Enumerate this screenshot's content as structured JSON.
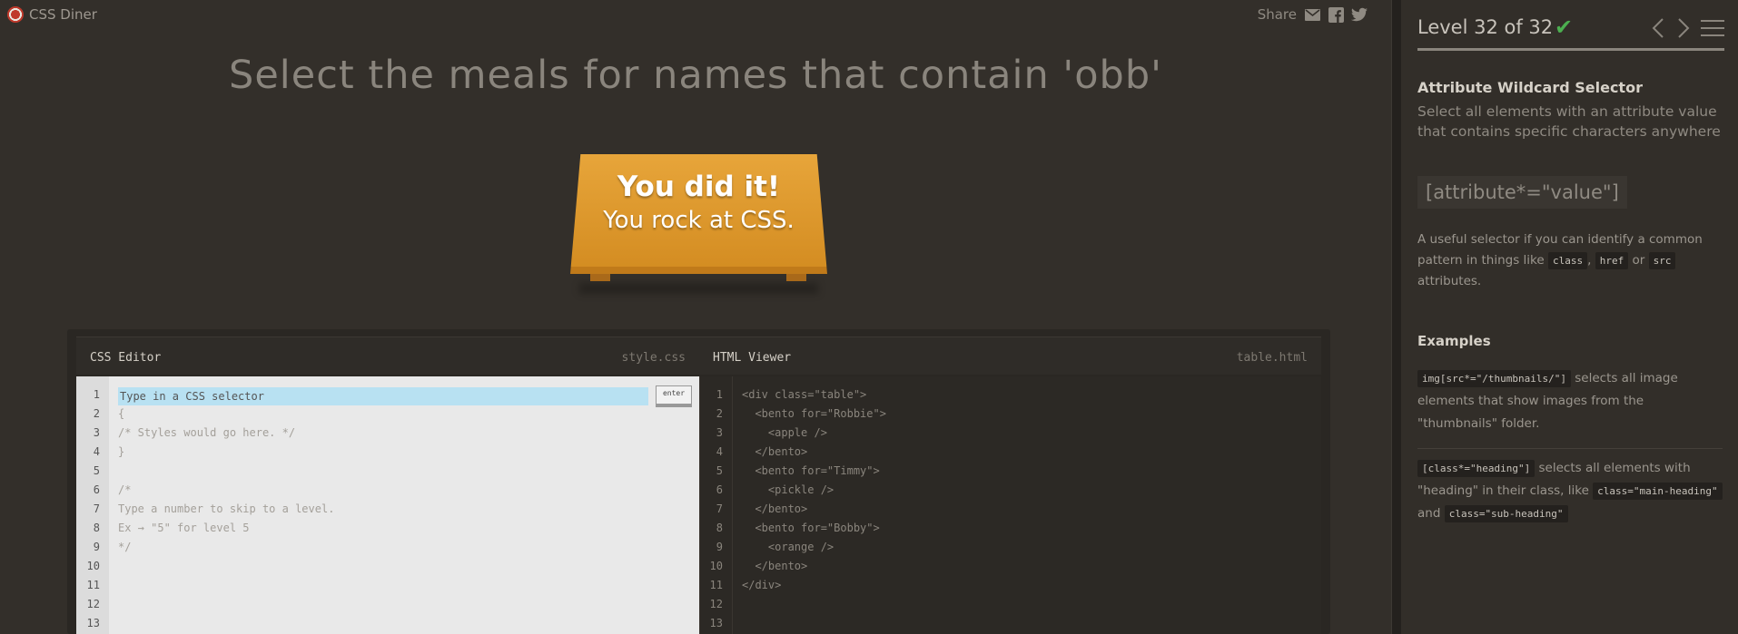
{
  "app": {
    "name": "CSS Diner"
  },
  "share": {
    "label": "Share"
  },
  "instruction": "Select the meals for names that contain 'obb'",
  "table": {
    "line1": "You did it!",
    "line2": "You rock at CSS."
  },
  "css_editor": {
    "title": "CSS Editor",
    "file": "style.css",
    "placeholder": "Type in a CSS selector",
    "enter_label": "enter",
    "line_numbers": [
      "1",
      "2",
      "3",
      "4",
      "5",
      "6",
      "7",
      "8",
      "9",
      "10",
      "11",
      "12",
      "13"
    ],
    "lines": [
      "",
      "{",
      "/* Styles would go here. */",
      "}",
      "",
      "/*",
      "Type a number to skip to a level.",
      "Ex → \"5\" for level 5",
      "*/",
      "",
      "",
      "",
      ""
    ]
  },
  "html_viewer": {
    "title": "HTML Viewer",
    "file": "table.html",
    "line_numbers": [
      "1",
      "2",
      "3",
      "4",
      "5",
      "6",
      "7",
      "8",
      "9",
      "10",
      "11",
      "12",
      "13"
    ],
    "lines": [
      "<div class=\"table\">",
      "  <bento for=\"Robbie\">",
      "    <apple />",
      "  </bento>",
      "  <bento for=\"Timmy\">",
      "    <pickle />",
      "  </bento>",
      "  <bento for=\"Bobby\">",
      "    <orange />",
      "  </bento>",
      "</div>",
      "",
      ""
    ]
  },
  "sidebar": {
    "level": "Level 32 of 32",
    "check": "✔",
    "progress": 1.0,
    "selector_name": "Attribute Wildcard Selector",
    "selector_desc": "Select all elements with an attribute value that contains specific characters anywhere",
    "syntax": "[attribute*=\"value\"]",
    "hint": {
      "pre": "A useful selector if you can identify a common pattern in things like",
      "c1": "class",
      "sep1": ",",
      "c2": "href",
      "sep2": "or",
      "c3": "src",
      "post": "attributes."
    },
    "examples_heading": "Examples",
    "ex1": {
      "code": "img[src*=\"/thumbnails/\"]",
      "text": "selects all image elements that show images from the \"thumbnails\" folder."
    },
    "ex2": {
      "code": "[class*=\"heading\"]",
      "text": "selects all elements with \"heading\" in their class, like",
      "code2": "class=\"main-heading\"",
      "and": "and",
      "code3": "class=\"sub-heading\""
    }
  },
  "colors": {
    "accent": "#e7a53a",
    "check": "#4caf50",
    "input_highlight": "#b8e1f2"
  }
}
